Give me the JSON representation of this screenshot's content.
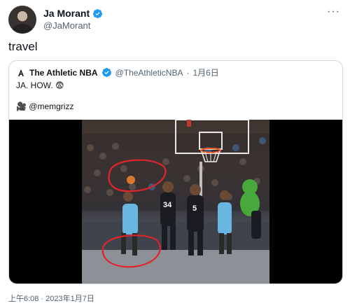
{
  "author": {
    "display_name": "Ja Morant",
    "handle": "@JaMorant",
    "more_icon": "more-horizontal-icon"
  },
  "tweet": {
    "text": "travel",
    "timestamp": "上午6:08 · 2023年1月7日"
  },
  "quoted_tweet": {
    "display_name": "The Athletic NBA",
    "handle": "@TheAthleticNBA",
    "separator": "·",
    "date": "1月6日",
    "text": "JA. HOW. 😨",
    "credit": "🎥 @memgrizz",
    "video": {
      "jersey_numbers": [
        "34",
        "5"
      ]
    }
  },
  "colors": {
    "verified": "#1d9bf0",
    "secondary_text": "#536471",
    "annotation_circle": "#e0242b",
    "border": "#cfd9de"
  }
}
